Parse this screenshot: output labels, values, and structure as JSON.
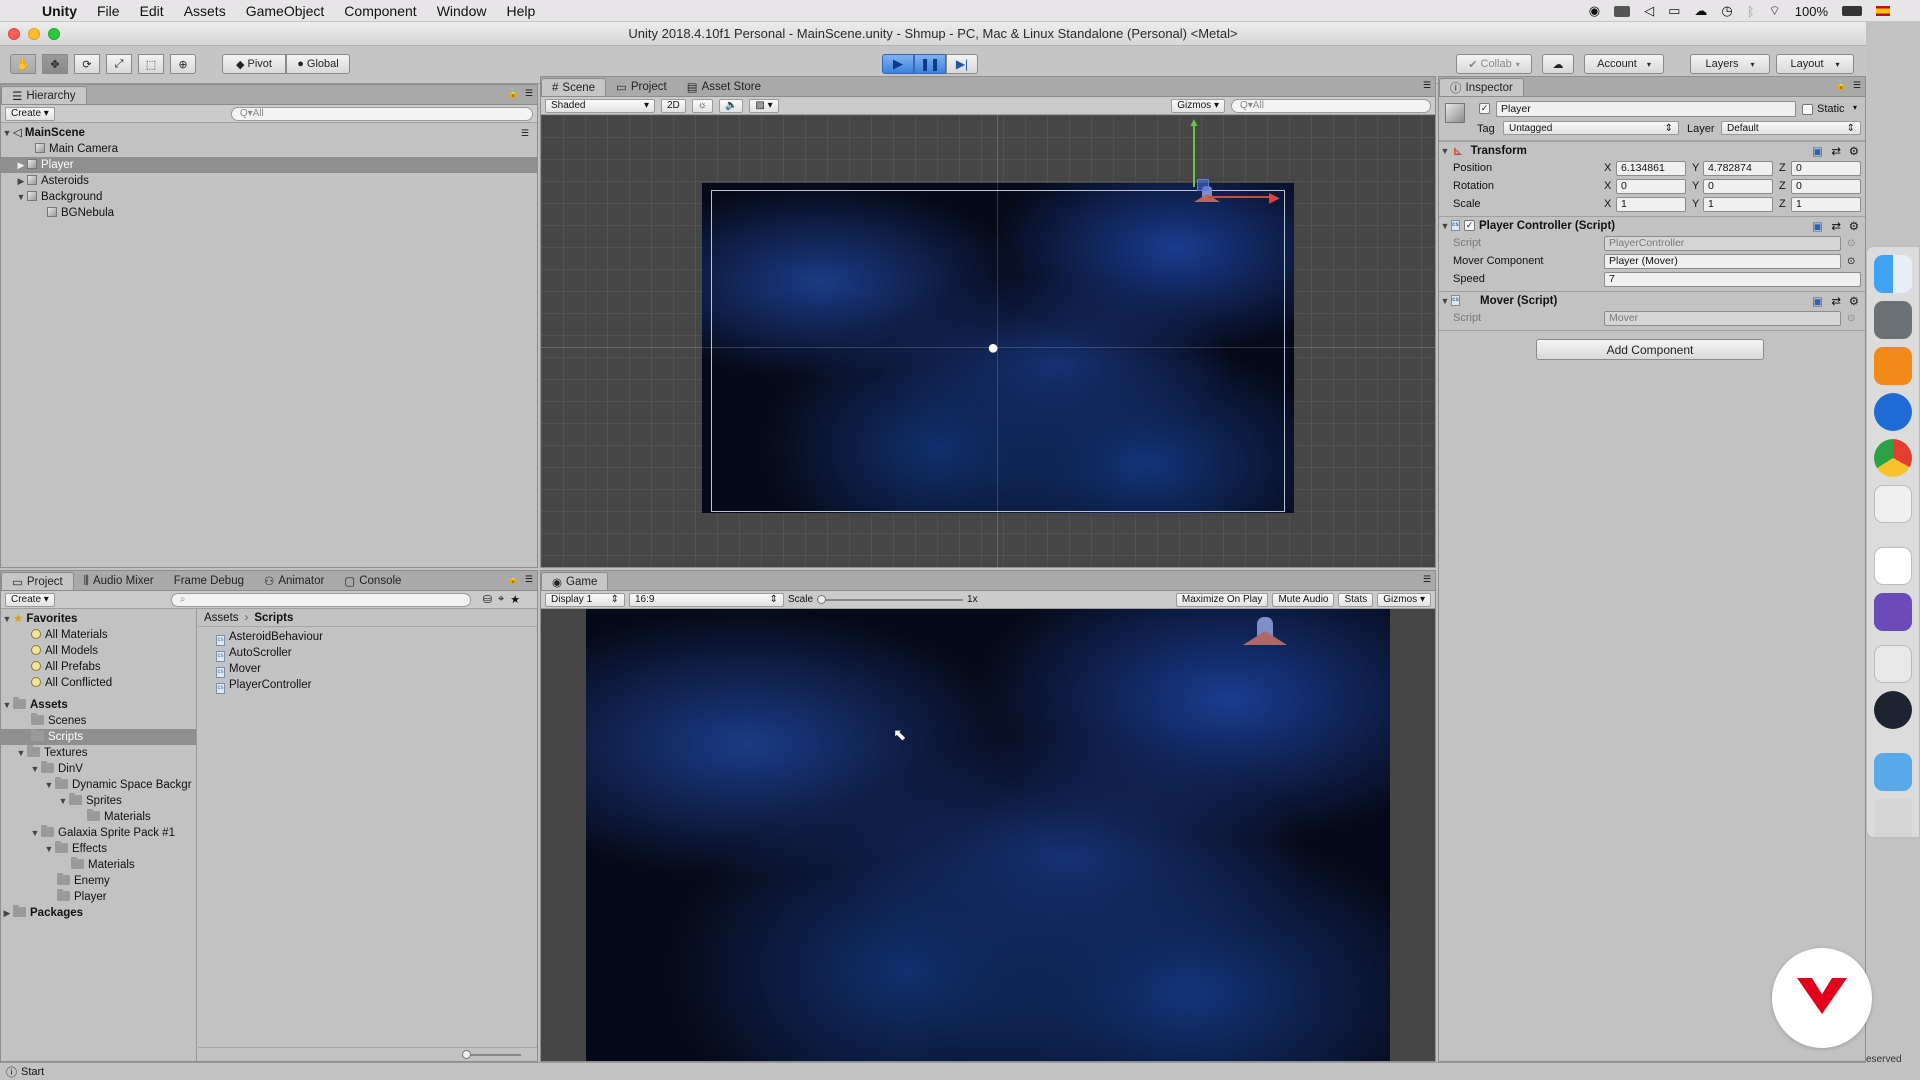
{
  "menubar": {
    "items": [
      "Unity",
      "File",
      "Edit",
      "Assets",
      "GameObject",
      "Component",
      "Window",
      "Help"
    ],
    "battery": "100%"
  },
  "window": {
    "title": "Unity 2018.4.10f1 Personal - MainScene.unity - Shmup - PC, Mac & Linux Standalone (Personal) <Metal>"
  },
  "toolbar": {
    "pivot": "Pivot",
    "global": "Global",
    "collab": "Collab",
    "account": "Account",
    "layers": "Layers",
    "layout": "Layout"
  },
  "hierarchy": {
    "tab": "Hierarchy",
    "create": "Create",
    "search_placeholder": "Q▾All",
    "scene": "MainScene",
    "items": [
      {
        "label": "Main Camera"
      },
      {
        "label": "Player"
      },
      {
        "label": "Asteroids"
      },
      {
        "label": "Background"
      },
      {
        "label": "BGNebula"
      }
    ]
  },
  "scene_view": {
    "tabs": [
      "Scene",
      "Project",
      "Asset Store"
    ],
    "shading": "Shaded",
    "mode2d": "2D",
    "gizmos": "Gizmos",
    "search_placeholder": "Q▾All"
  },
  "game_view": {
    "tab": "Game",
    "display": "Display 1",
    "aspect": "16:9",
    "scale_label": "Scale",
    "scale_value": "1x",
    "maximize": "Maximize On Play",
    "mute": "Mute Audio",
    "stats": "Stats",
    "gizmos": "Gizmos"
  },
  "project": {
    "tabs": [
      "Project",
      "Audio Mixer",
      "Frame Debug",
      "Animator",
      "Console"
    ],
    "create": "Create",
    "favorites_label": "Favorites",
    "favorites": [
      "All Materials",
      "All Models",
      "All Prefabs",
      "All Conflicted"
    ],
    "assets_label": "Assets",
    "tree": [
      {
        "label": "Scenes"
      },
      {
        "label": "Scripts"
      },
      {
        "label": "Textures"
      },
      {
        "label": "DinV"
      },
      {
        "label": "Dynamic Space Backgr"
      },
      {
        "label": "Sprites"
      },
      {
        "label": "Materials"
      },
      {
        "label": "Galaxia Sprite Pack #1"
      },
      {
        "label": "Effects"
      },
      {
        "label": "Materials"
      },
      {
        "label": "Enemy"
      },
      {
        "label": "Player"
      }
    ],
    "packages_label": "Packages",
    "breadcrumb": [
      "Assets",
      "Scripts"
    ],
    "files": [
      "AsteroidBehaviour",
      "AutoScroller",
      "Mover",
      "PlayerController"
    ]
  },
  "inspector": {
    "tab": "Inspector",
    "object_name": "Player",
    "static_label": "Static",
    "tag_label": "Tag",
    "tag_value": "Untagged",
    "layer_label": "Layer",
    "layer_value": "Default",
    "transform": {
      "title": "Transform",
      "position_label": "Position",
      "rotation_label": "Rotation",
      "scale_label": "Scale",
      "position": {
        "x": "6.134861",
        "y": "4.782874",
        "z": "0"
      },
      "rotation": {
        "x": "0",
        "y": "0",
        "z": "0"
      },
      "scale": {
        "x": "1",
        "y": "1",
        "z": "1"
      }
    },
    "player_controller": {
      "title": "Player Controller (Script)",
      "script_label": "Script",
      "script_value": "PlayerController",
      "mover_label": "Mover Component",
      "mover_value": "Player (Mover)",
      "speed_label": "Speed",
      "speed_value": "7"
    },
    "mover": {
      "title": "Mover (Script)",
      "script_label": "Script",
      "script_value": "Mover"
    },
    "add_component": "Add Component"
  },
  "status": {
    "text": "Start"
  },
  "watermark": "eserved"
}
